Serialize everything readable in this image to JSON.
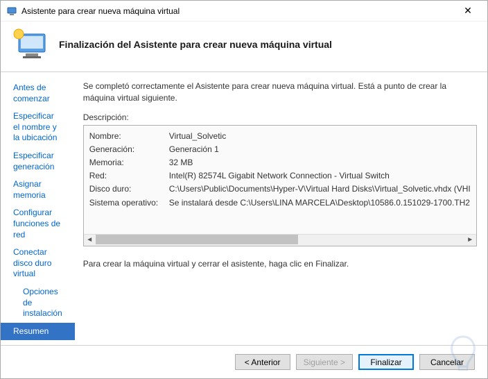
{
  "window": {
    "title": "Asistente para crear nueva máquina virtual"
  },
  "header": {
    "title": "Finalización del Asistente para crear nueva máquina virtual"
  },
  "sidebar": {
    "items": [
      {
        "label": "Antes de comenzar",
        "indent": false,
        "selected": false
      },
      {
        "label": "Especificar el nombre y la ubicación",
        "indent": false,
        "selected": false
      },
      {
        "label": "Especificar generación",
        "indent": false,
        "selected": false
      },
      {
        "label": "Asignar memoria",
        "indent": false,
        "selected": false
      },
      {
        "label": "Configurar funciones de red",
        "indent": false,
        "selected": false
      },
      {
        "label": "Conectar disco duro virtual",
        "indent": false,
        "selected": false
      },
      {
        "label": "Opciones de instalación",
        "indent": true,
        "selected": false
      },
      {
        "label": "Resumen",
        "indent": false,
        "selected": true
      }
    ]
  },
  "main": {
    "intro": "Se completó correctamente el Asistente para crear nueva máquina virtual. Está a punto de crear la máquina virtual siguiente.",
    "desc_label": "Descripción:",
    "rows": [
      {
        "key": "Nombre:",
        "val": "Virtual_Solvetic"
      },
      {
        "key": "Generación:",
        "val": "Generación 1"
      },
      {
        "key": "Memoria:",
        "val": "32 MB"
      },
      {
        "key": "Red:",
        "val": "Intel(R) 82574L Gigabit Network Connection - Virtual Switch"
      },
      {
        "key": "Disco duro:",
        "val": "C:\\Users\\Public\\Documents\\Hyper-V\\Virtual Hard Disks\\Virtual_Solvetic.vhdx (VHI"
      },
      {
        "key": "Sistema operativo:",
        "val": "Se instalará desde C:\\Users\\LINA MARCELA\\Desktop\\10586.0.151029-1700.TH2"
      }
    ],
    "footer_note": "Para crear la máquina virtual y cerrar el asistente, haga clic en Finalizar."
  },
  "buttons": {
    "prev": "< Anterior",
    "next": "Siguiente >",
    "finish": "Finalizar",
    "cancel": "Cancelar"
  }
}
